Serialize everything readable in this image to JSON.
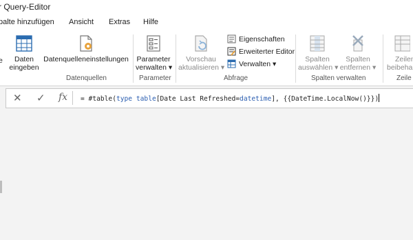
{
  "window": {
    "title": "r Query-Editor"
  },
  "tabs": [
    "palte hinzufügen",
    "Ansicht",
    "Extras",
    "Hilfe"
  ],
  "ribbon": {
    "enter_data": {
      "line1": "Daten",
      "line2": "eingeben"
    },
    "partial_left": "e",
    "datasource_settings": "Datenquelleneinstellungen",
    "group_datasources": "Datenquellen",
    "parameters": {
      "line1": "Parameter",
      "line2": "verwalten ▾"
    },
    "group_parameters": "Parameter",
    "refresh_preview": {
      "line1": "Vorschau",
      "line2": "aktualisieren ▾"
    },
    "properties": "Eigenschaften",
    "advanced_editor": "Erweiterter Editor",
    "manage": "Verwalten ▾",
    "group_query": "Abfrage",
    "choose_columns": {
      "line1": "Spalten",
      "line2": "auswählen ▾"
    },
    "remove_columns": {
      "line1": "Spalten",
      "line2": "entfernen ▾"
    },
    "group_manage_columns": "Spalten verwalten",
    "keep_rows": {
      "line1": "Zeilen",
      "line2": "beibehalt"
    },
    "group_rows": "Zeile"
  },
  "formula_bar": {
    "cancel": "✕",
    "commit": "✓",
    "fx": "fx",
    "tokens": [
      {
        "t": "= #table(",
        "c": ""
      },
      {
        "t": "type table",
        "c": "kw"
      },
      {
        "t": "[Date Last Refreshed=",
        "c": ""
      },
      {
        "t": "datetime",
        "c": "kw"
      },
      {
        "t": "], {{DateTime.LocalNow()}})",
        "c": ""
      }
    ]
  }
}
